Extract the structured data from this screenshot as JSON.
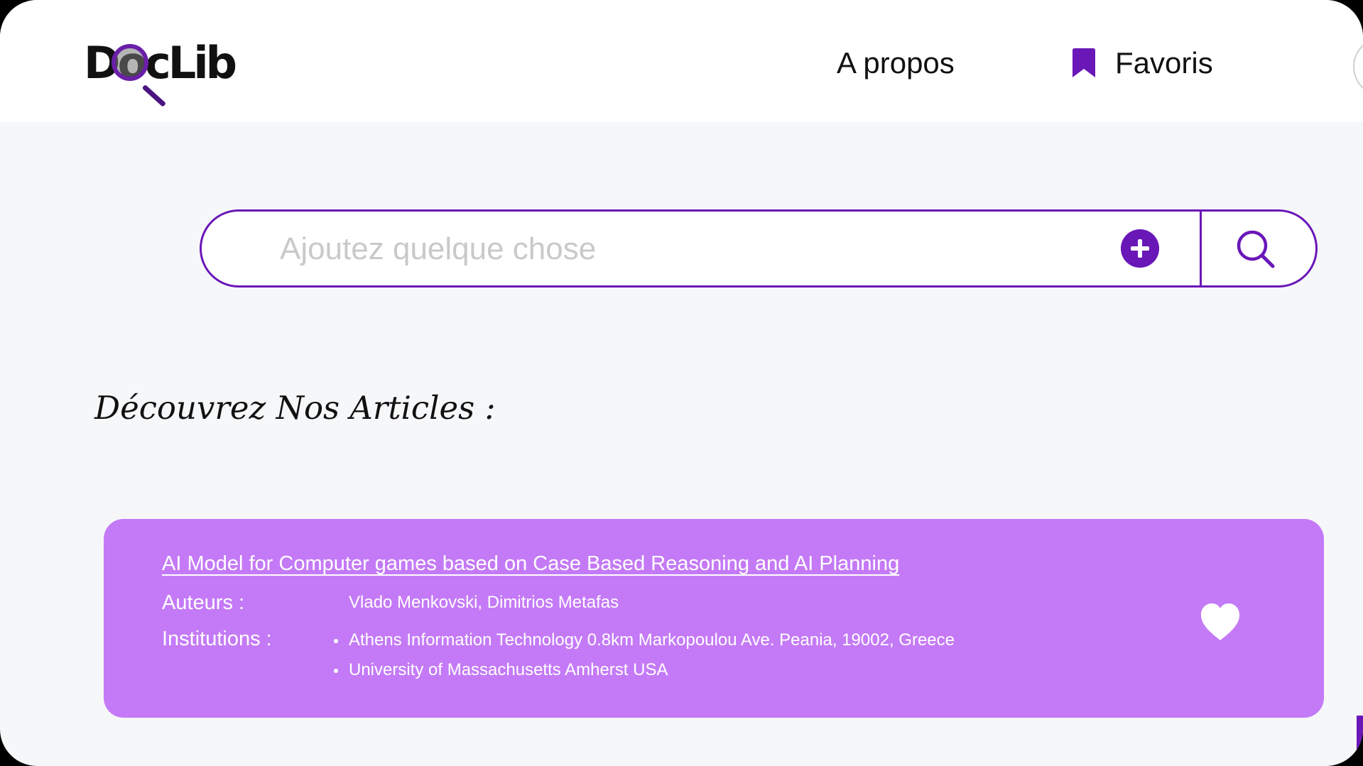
{
  "header": {
    "logo_text": "DocLib",
    "nav_about_label": "A propos",
    "nav_favorites_label": "Favoris",
    "favorites_icon": "bookmark-icon"
  },
  "search": {
    "placeholder": "Ajoutez quelque chose",
    "value": "",
    "add_icon": "plus-circle-icon",
    "search_icon": "magnifier-icon"
  },
  "section": {
    "title": "Découvrez Nos Articles :"
  },
  "articles": [
    {
      "title": "AI Model for Computer games based on Case Based Reasoning and AI Planning",
      "authors_label": "Auteurs :",
      "authors": "Vlado Menkovski, Dimitrios Metafas",
      "institutions_label": "Institutions :",
      "institutions": [
        "Athens Information Technology 0.8km Markopoulou Ave. Peania, 19002, Greece",
        "University of Massachusetts Amherst USA"
      ],
      "favorite_icon": "heart-icon"
    }
  ],
  "colors": {
    "accent": "#6a17b8",
    "card_background": "#c47af6",
    "page_background": "#f6f7f9",
    "header_background": "#ffffff",
    "placeholder_text": "#c9c9c9"
  }
}
